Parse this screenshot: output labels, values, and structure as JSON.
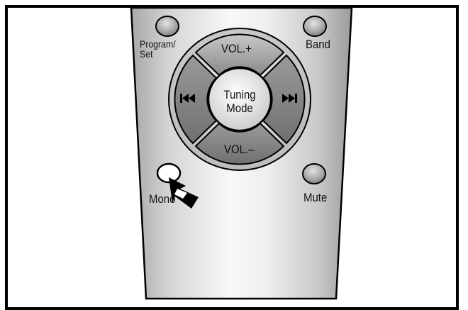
{
  "remote": {
    "buttons": {
      "program_set": {
        "line1": "Program/",
        "line2": "Set"
      },
      "band": "Band",
      "vol_up": "VOL.+",
      "vol_down": "VOL.–",
      "tuning_mode": {
        "line1": "Tuning",
        "line2": "Mode"
      },
      "mono": "Mono",
      "mute": "Mute"
    },
    "icons": {
      "rewind": "skip-back-icon",
      "forward": "skip-forward-icon",
      "pointer": "press-arrow-icon"
    },
    "colors": {
      "body_light": "#f4f4f4",
      "body_mid": "#c4c4c4",
      "button_dark": "#8e8e8e",
      "outline": "#000000"
    }
  }
}
